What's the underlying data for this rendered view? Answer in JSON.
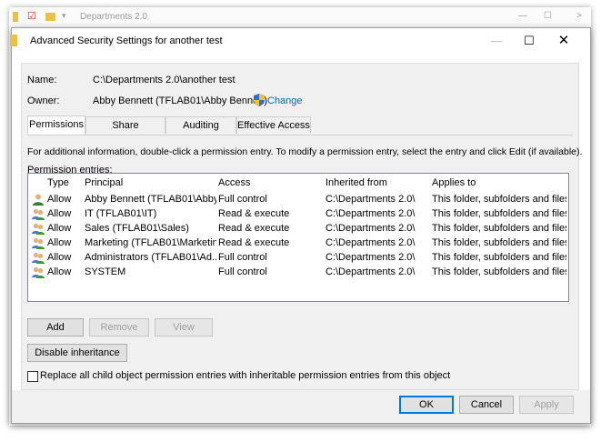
{
  "background_window": {
    "title": "Departments 2.0"
  },
  "dialog": {
    "title": "Advanced Security Settings for another test",
    "name_label": "Name:",
    "name_value": "C:\\Departments 2.0\\another test",
    "owner_label": "Owner:",
    "owner_value": "Abby Bennett (TFLAB01\\Abby Bennett)",
    "change_label": "Change",
    "tabs": [
      {
        "label": "Permissions",
        "active": true
      },
      {
        "label": "Share",
        "active": false
      },
      {
        "label": "Auditing",
        "active": false
      },
      {
        "label": "Effective Access",
        "active": false
      }
    ],
    "info_text": "For additional information, double-click a permission entry. To modify a permission entry, select the entry and click Edit (if available).",
    "entries_label": "Permission entries:",
    "columns": [
      "Type",
      "Principal",
      "Access",
      "Inherited from",
      "Applies to"
    ],
    "entries": [
      {
        "icon": "user-icon",
        "type": "Allow",
        "principal": "Abby Bennett (TFLAB01\\Abby...",
        "access": "Full control",
        "inherited": "C:\\Departments 2.0\\",
        "applies": "This folder, subfolders and files"
      },
      {
        "icon": "group-icon",
        "type": "Allow",
        "principal": "IT (TFLAB01\\IT)",
        "access": "Read & execute",
        "inherited": "C:\\Departments 2.0\\",
        "applies": "This folder, subfolders and files"
      },
      {
        "icon": "group-icon",
        "type": "Allow",
        "principal": "Sales (TFLAB01\\Sales)",
        "access": "Read & execute",
        "inherited": "C:\\Departments 2.0\\",
        "applies": "This folder, subfolders and files"
      },
      {
        "icon": "group-icon",
        "type": "Allow",
        "principal": "Marketing (TFLAB01\\Marketin...",
        "access": "Read & execute",
        "inherited": "C:\\Departments 2.0\\",
        "applies": "This folder, subfolders and files"
      },
      {
        "icon": "group-icon",
        "type": "Allow",
        "principal": "Administrators (TFLAB01\\Ad...",
        "access": "Full control",
        "inherited": "C:\\Departments 2.0\\",
        "applies": "This folder, subfolders and files"
      },
      {
        "icon": "group-icon",
        "type": "Allow",
        "principal": "SYSTEM",
        "access": "Full control",
        "inherited": "C:\\Departments 2.0\\",
        "applies": "This folder, subfolders and files"
      }
    ],
    "add_label": "Add",
    "remove_label": "Remove",
    "view_label": "View",
    "disable_inheritance_label": "Disable inheritance",
    "replace_label": "Replace all child object permission entries with inheritable permission entries from this object",
    "ok_label": "OK",
    "cancel_label": "Cancel",
    "apply_label": "Apply"
  },
  "colors": {
    "link": "#0066cc",
    "accent": "#0078d7"
  }
}
